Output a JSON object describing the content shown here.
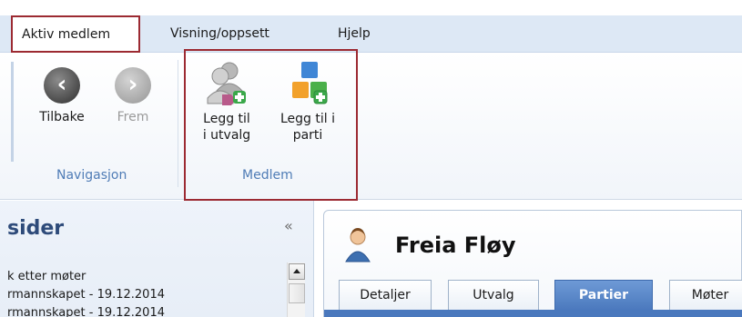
{
  "menubar": {
    "tabs": [
      {
        "label": "Aktiv medlem"
      },
      {
        "label": "Visning/oppsett"
      },
      {
        "label": "Hjelp"
      }
    ]
  },
  "ribbon": {
    "groups": [
      {
        "label": "Navigasjon",
        "buttons": [
          {
            "label": "Tilbake",
            "icon": "arrow-left-icon",
            "enabled": true
          },
          {
            "label": "Frem",
            "icon": "arrow-right-icon",
            "enabled": false
          }
        ]
      },
      {
        "label": "Medlem",
        "buttons": [
          {
            "label_line1": "Legg til",
            "label_line2": "i utvalg",
            "icon": "add-to-committee-icon"
          },
          {
            "label_line1": "Legg til i",
            "label_line2": "parti",
            "icon": "add-to-party-icon"
          }
        ]
      }
    ]
  },
  "left_panel": {
    "title": "sider",
    "collapse_glyph": "«",
    "items": [
      "k etter møter",
      "rmannskapet - 19.12.2014",
      "rmannskapet - 19.12.2014"
    ]
  },
  "member": {
    "name": "Freia Fløy",
    "tabs": [
      "Detaljer",
      "Utvalg",
      "Partier",
      "Møter"
    ],
    "active_tab": "Partier"
  },
  "colors": {
    "highlight_border": "#9c2a32",
    "ribbon_strip": "#dde8f5",
    "group_label": "#4f7cb6",
    "active_tab": "#4a78bd"
  }
}
